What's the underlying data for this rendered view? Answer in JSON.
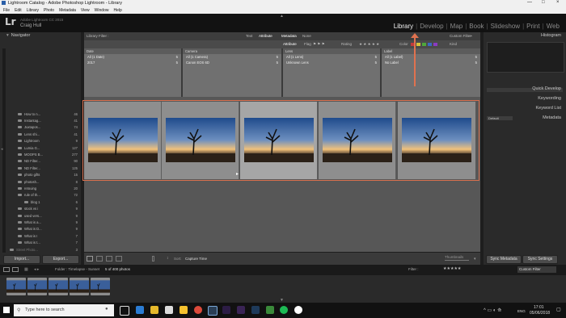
{
  "window": {
    "title": "Lightroom Catalog - Adobe Photoshop Lightroom - Library"
  },
  "menu": [
    "File",
    "Edit",
    "Library",
    "Photo",
    "Metadata",
    "View",
    "Window",
    "Help"
  ],
  "identity": {
    "logo": "Lr",
    "catalog_name": "Adobe Lightroom CC 2015",
    "user": "Craig Hull"
  },
  "modules": [
    {
      "label": "Library",
      "active": true
    },
    {
      "label": "Develop"
    },
    {
      "label": "Map"
    },
    {
      "label": "Book"
    },
    {
      "label": "Slideshow"
    },
    {
      "label": "Print"
    },
    {
      "label": "Web"
    }
  ],
  "left_panel": {
    "navigator": "Navigator",
    "folders": [
      {
        "name": "How to n...",
        "count": "46"
      },
      {
        "name": "Instantag...",
        "count": "41"
      },
      {
        "name": "Juxtapos...",
        "count": "74"
      },
      {
        "name": "Lens shi...",
        "count": "41"
      },
      {
        "name": "Lightroom",
        "count": "9"
      },
      {
        "name": "Lumia G...",
        "count": "127"
      },
      {
        "name": "MOOPS B...",
        "count": "277"
      },
      {
        "name": "ND Filter...",
        "count": "90"
      },
      {
        "name": "ND Filter...",
        "count": "125"
      },
      {
        "name": "photo gifts",
        "count": "15"
      },
      {
        "name": "photosh...",
        "count": "8"
      },
      {
        "name": "retouing",
        "count": "20"
      },
      {
        "name": "rule of th...",
        "count": "72"
      },
      {
        "name": "blog 1",
        "count": "6"
      },
      {
        "name": "stock vs i",
        "count": "9"
      },
      {
        "name": "used vers...",
        "count": "9"
      },
      {
        "name": "What is a...",
        "count": "9"
      },
      {
        "name": "What is D...",
        "count": "9"
      },
      {
        "name": "What is I",
        "count": "7"
      },
      {
        "name": "What is t...",
        "count": "7"
      },
      {
        "name": "Street Photo...",
        "count": "3"
      },
      {
        "name": "Time-lapse...",
        "count": "5"
      },
      {
        "name": "Timelapse - Sun",
        "count": "400"
      },
      {
        "name": "Pictures",
        "count": "195"
      }
    ],
    "import_label": "Import...",
    "export_label": "Export..."
  },
  "filter_bar": {
    "title": "Library Filter :",
    "tabs": [
      "Text",
      "Attribute",
      "Metadata",
      "None"
    ],
    "custom_filter": "Custom Filter",
    "attribute_label": "Attribute",
    "flag_label": "Flag",
    "rating_label": "Rating",
    "color_label": "Color",
    "kind_label": "Kind"
  },
  "metadata_columns": [
    {
      "header": "Date",
      "rows": [
        {
          "label": "All (1 Date)",
          "n": "5"
        },
        {
          "label": "2017",
          "n": "5"
        }
      ]
    },
    {
      "header": "Camera",
      "rows": [
        {
          "label": "All (1 Camera)",
          "n": "5"
        },
        {
          "label": "Canon EOS 6D",
          "n": "5"
        }
      ]
    },
    {
      "header": "Lens",
      "rows": [
        {
          "label": "All (1 Lens)",
          "n": "5"
        },
        {
          "label": "Unknown Lens",
          "n": "5"
        }
      ]
    },
    {
      "header": "Label",
      "rows": [
        {
          "label": "All (1 Label)",
          "n": "5"
        },
        {
          "label": "No Label",
          "n": "5"
        }
      ]
    }
  ],
  "right_panel": {
    "histogram": "Histogram",
    "quick_develop": "Quick Develop",
    "keywording": "Keywording",
    "keyword_list": "Keyword List",
    "metadata": "Metadata",
    "default_label": "Default",
    "sync_metadata": "Sync Metadata",
    "sync_settings": "Sync Settings"
  },
  "toolbar": {
    "sort_label": "Sort:",
    "sort_value": "Capture Time",
    "thumbnails_label": "Thumbnails"
  },
  "filmstrip_bar": {
    "source": "Folder : Timelapse - Sunset",
    "count": "5 of 400 photos",
    "filter_label": "Filter :",
    "filter_value": "Custom Filter"
  },
  "taskbar": {
    "search_placeholder": "Type here to search",
    "lang": "ENG",
    "time": "17:01",
    "date": "05/06/2018"
  },
  "colors": {
    "accent": "#e0724f",
    "selection": "#d9704e"
  }
}
